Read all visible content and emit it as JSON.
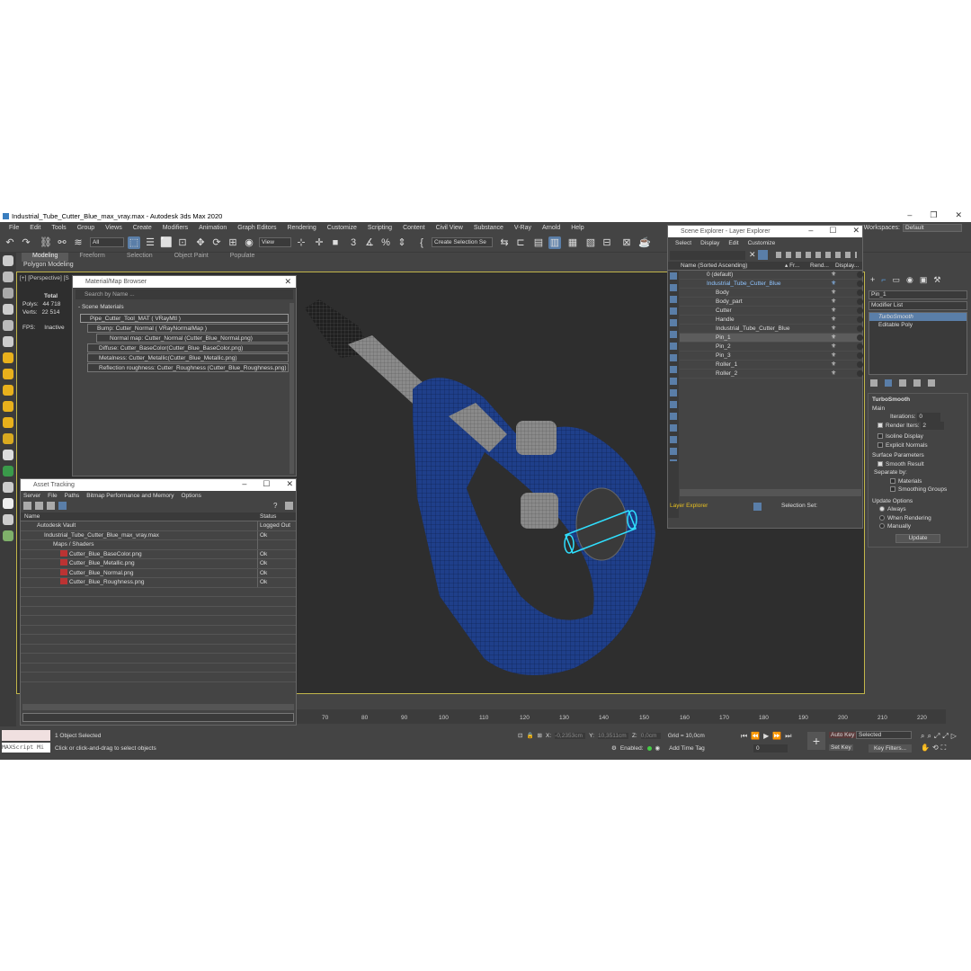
{
  "app": {
    "title": "Industrial_Tube_Cutter_Blue_max_vray.max - Autodesk 3ds Max 2020",
    "menu": [
      "File",
      "Edit",
      "Tools",
      "Group",
      "Views",
      "Create",
      "Modifiers",
      "Animation",
      "Graph Editors",
      "Rendering",
      "Customize",
      "Scripting",
      "Content",
      "Civil View",
      "Substance",
      "V-Ray",
      "Arnold",
      "Help"
    ],
    "workspaces_label": "Workspaces:",
    "workspaces_value": "Default",
    "toolbar": {
      "filter": "All",
      "view": "View",
      "selection_set": "Create Selection Se"
    },
    "ribbon_tabs": [
      "Modeling",
      "Freeform",
      "Selection",
      "Object Paint",
      "Populate"
    ],
    "ribbon_sub": "Polygon Modeling"
  },
  "viewport": {
    "label": "[+] [Perspective] [S",
    "stats": {
      "total_label": "Total",
      "polys_label": "Polys:",
      "polys": "44 718",
      "verts_label": "Verts:",
      "verts": "22 514",
      "fps_label": "FPS:",
      "fps": "Inactive"
    }
  },
  "material_browser": {
    "title": "Material/Map Browser",
    "search_placeholder": "Search by Name ...",
    "section": "- Scene Materials",
    "items": [
      "Pipe_Cutter_Tool_MAT  ( VRayMtl )",
      "Bump: Cutter_Normal  ( VRayNormalMap )",
      "Normal map: Cutter_Normal (Cutter_Blue_Normal.png)",
      "Diffuse: Cutter_BaseColor(Cutter_Blue_BaseColor.png)",
      "Metalness: Cutter_Metallic(Cutter_Blue_Metallic.png)",
      "Reflection roughness: Cutter_Roughness (Cutter_Blue_Roughness.png)"
    ]
  },
  "asset_tracking": {
    "title": "Asset Tracking",
    "menu": [
      "Server",
      "File",
      "Paths",
      "Bitmap Performance and Memory",
      "Options"
    ],
    "col_name": "Name",
    "col_status": "Status",
    "rows": [
      {
        "name": "Autodesk Vault",
        "status": "Logged Out"
      },
      {
        "name": "Industrial_Tube_Cutter_Blue_max_vray.max",
        "status": "Ok"
      },
      {
        "name": "Maps / Shaders",
        "status": ""
      },
      {
        "name": "Cutter_Blue_BaseColor.png",
        "status": "Ok"
      },
      {
        "name": "Cutter_Blue_Metallic.png",
        "status": "Ok"
      },
      {
        "name": "Cutter_Blue_Normal.png",
        "status": "Ok"
      },
      {
        "name": "Cutter_Blue_Roughness.png",
        "status": "Ok"
      }
    ]
  },
  "scene_explorer": {
    "title": "Scene Explorer - Layer Explorer",
    "menu": [
      "Select",
      "Display",
      "Edit",
      "Customize"
    ],
    "col_name": "Name (Sorted Ascending)",
    "col_fr": "▴ Fr...",
    "col_rend": "Rend...",
    "col_disp": "Display...",
    "rows": [
      "0 (default)",
      "Industrial_Tube_Cutter_Blue",
      "Body",
      "Body_part",
      "Cutter",
      "Handle",
      "Industrial_Tube_Cutter_Blue",
      "Pin_1",
      "Pin_2",
      "Pin_3",
      "Roller_1",
      "Roller_2"
    ],
    "footer_explorer": "Layer Explorer",
    "footer_selset": "Selection Set:"
  },
  "command_panel": {
    "object_name": "Pin_1",
    "modifier_list": "Modifier List",
    "stack": [
      "TurboSmooth",
      "Editable Poly"
    ],
    "rollout": "TurboSmooth",
    "main": "Main",
    "iterations_label": "Iterations:",
    "iterations": "0",
    "render_iters_label": "Render Iters:",
    "render_iters": "2",
    "isoline": "Isoline Display",
    "explicit": "Explicit Normals",
    "surface": "Surface Parameters",
    "smooth": "Smooth Result",
    "separate": "Separate by:",
    "materials": "Materials",
    "smoothing_groups": "Smoothing Groups",
    "update_options": "Update Options",
    "always": "Always",
    "when_rendering": "When Rendering",
    "manually": "Manually",
    "update_btn": "Update"
  },
  "timeline": {
    "ticks": [
      "70",
      "80",
      "90",
      "100",
      "110",
      "120",
      "130",
      "140",
      "150",
      "160",
      "170",
      "180",
      "190",
      "200",
      "210",
      "220"
    ]
  },
  "status": {
    "script": "MAXScript Mi",
    "selected": "1 Object Selected",
    "hint": "Click or click-and-drag to select objects",
    "x_label": "X:",
    "x": "-0,2353cm",
    "y_label": "Y:",
    "y": "10,3511cm",
    "z_label": "Z:",
    "z": "0,0cm",
    "grid": "Grid = 10,0cm",
    "enabled": "Enabled:",
    "add_time_tag": "Add Time Tag",
    "auto_key": "Auto Key",
    "selected_dd": "Selected",
    "set_key": "Set Key",
    "key_filters": "Key Filters...",
    "frame": "0"
  },
  "colors": {
    "accent": "#5a7ea8",
    "viewport_border": "#c2b64a",
    "cutter_blue": "#1f3f8a"
  }
}
